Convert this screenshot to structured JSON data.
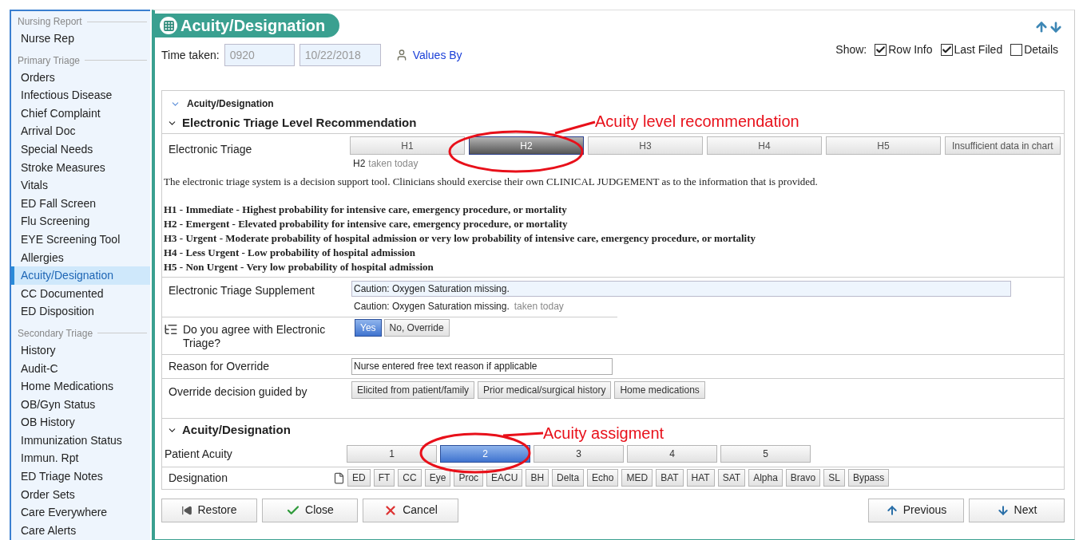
{
  "sidebar": {
    "sections": [
      {
        "title": "Nursing Report",
        "items": [
          {
            "label": "Nurse Rep",
            "selected": false
          }
        ]
      },
      {
        "title": "Primary Triage",
        "items": [
          {
            "label": "Orders",
            "selected": false
          },
          {
            "label": "Infectious Disease",
            "selected": false
          },
          {
            "label": "Chief Complaint",
            "selected": false
          },
          {
            "label": "Arrival Doc",
            "selected": false
          },
          {
            "label": "Special Needs",
            "selected": false
          },
          {
            "label": "Stroke Measures",
            "selected": false
          },
          {
            "label": "Vitals",
            "selected": false
          },
          {
            "label": "ED Fall Screen",
            "selected": false
          },
          {
            "label": "Flu Screening",
            "selected": false
          },
          {
            "label": "EYE Screening Tool",
            "selected": false
          },
          {
            "label": "Allergies",
            "selected": false
          },
          {
            "label": "Acuity/Designation",
            "selected": true
          },
          {
            "label": "CC Documented",
            "selected": false
          },
          {
            "label": "ED Disposition",
            "selected": false
          }
        ]
      },
      {
        "title": "Secondary Triage",
        "items": [
          {
            "label": "History",
            "selected": false
          },
          {
            "label": "Audit-C",
            "selected": false
          },
          {
            "label": "Home Medications",
            "selected": false
          },
          {
            "label": "OB/Gyn Status",
            "selected": false
          },
          {
            "label": "OB History",
            "selected": false
          },
          {
            "label": "Immunization Status",
            "selected": false
          },
          {
            "label": "Immun. Rpt",
            "selected": false
          },
          {
            "label": "ED Triage Notes",
            "selected": false
          },
          {
            "label": "Order Sets",
            "selected": false
          },
          {
            "label": "Care Everywhere",
            "selected": false
          },
          {
            "label": "Care Alerts",
            "selected": false
          }
        ]
      }
    ]
  },
  "header": {
    "title": "Acuity/Designation"
  },
  "time_taken": {
    "label": "Time taken:",
    "time": "0920",
    "date": "10/22/2018",
    "values_by": "Values By"
  },
  "show": {
    "label": "Show:",
    "options": [
      {
        "label": "Row Info",
        "checked": true
      },
      {
        "label": "Last Filed",
        "checked": true
      },
      {
        "label": "Details",
        "checked": false
      }
    ]
  },
  "form": {
    "section_title": "Acuity/Designation",
    "recommendation": {
      "title": "Electronic Triage Level Recommendation",
      "row_label": "Electronic Triage",
      "options": [
        {
          "label": "H1",
          "selected": false
        },
        {
          "label": "H2",
          "selected": true
        },
        {
          "label": "H3",
          "selected": false
        },
        {
          "label": "H4",
          "selected": false
        },
        {
          "label": "H5",
          "selected": false
        },
        {
          "label": "Insufficient data in chart",
          "selected": false
        }
      ],
      "result": "H2",
      "result_note": "taken today",
      "disclaimer": "The electronic triage system is a decision support tool.  Clinicians should exercise their own CLINICAL JUDGEMENT as to the information that is provided.",
      "levels": [
        "H1 - Immediate - Highest probability for intensive care, emergency procedure, or mortality",
        "H2 - Emergent - Elevated probability for intensive care, emergency procedure, or mortality",
        "H3 - Urgent - Moderate probability of hospital admission or very low probability of intensive care, emergency procedure, or mortality",
        "H4 - Less Urgent - Low probability of hospital admission",
        "H5 - Non Urgent - Very low probability of hospital admission"
      ]
    },
    "supplement": {
      "label": "Electronic Triage Supplement",
      "value": "Caution: Oxygen Saturation missing.",
      "result": "Caution: Oxygen Saturation missing.",
      "result_note": "taken today"
    },
    "agree": {
      "label": "Do you agree with Electronic Triage?",
      "options": [
        {
          "label": "Yes",
          "selected": true
        },
        {
          "label": "No, Override",
          "selected": false
        }
      ]
    },
    "reason": {
      "label": "Reason for Override",
      "value": "Nurse entered free text reason if applicable"
    },
    "guided_by": {
      "label": "Override decision guided by",
      "options": [
        {
          "label": "Elicited from patient/family",
          "selected": false
        },
        {
          "label": "Prior medical/surgical history",
          "selected": false
        },
        {
          "label": "Home medications",
          "selected": false
        }
      ]
    },
    "acuity": {
      "title": "Acuity/Designation",
      "row_label": "Patient Acuity",
      "options": [
        {
          "label": "1",
          "selected": false
        },
        {
          "label": "2",
          "selected": true
        },
        {
          "label": "3",
          "selected": false
        },
        {
          "label": "4",
          "selected": false
        },
        {
          "label": "5",
          "selected": false
        }
      ]
    },
    "designation": {
      "label": "Designation",
      "options": [
        {
          "label": "ED",
          "selected": false
        },
        {
          "label": "FT",
          "selected": false
        },
        {
          "label": "CC",
          "selected": false
        },
        {
          "label": "Eye",
          "selected": false
        },
        {
          "label": "Proc",
          "selected": false
        },
        {
          "label": "EACU",
          "selected": false
        },
        {
          "label": "BH",
          "selected": false
        },
        {
          "label": "Delta",
          "selected": false
        },
        {
          "label": "Echo",
          "selected": false
        },
        {
          "label": "MED",
          "selected": false
        },
        {
          "label": "BAT",
          "selected": false
        },
        {
          "label": "HAT",
          "selected": false
        },
        {
          "label": "SAT",
          "selected": false
        },
        {
          "label": "Alpha",
          "selected": false
        },
        {
          "label": "Bravo",
          "selected": false
        },
        {
          "label": "SL",
          "selected": false
        },
        {
          "label": "Bypass",
          "selected": false
        }
      ]
    }
  },
  "footer": {
    "left": [
      {
        "kind": "restore",
        "label": "Restore"
      },
      {
        "kind": "close",
        "label": "Close"
      },
      {
        "kind": "cancel",
        "label": "Cancel"
      }
    ],
    "right": [
      {
        "kind": "previous",
        "label": "Previous"
      },
      {
        "kind": "next",
        "label": "Next"
      }
    ]
  },
  "annotations": [
    {
      "text": "Acuity level recommendation"
    },
    {
      "text": "Acuity assigment"
    }
  ]
}
